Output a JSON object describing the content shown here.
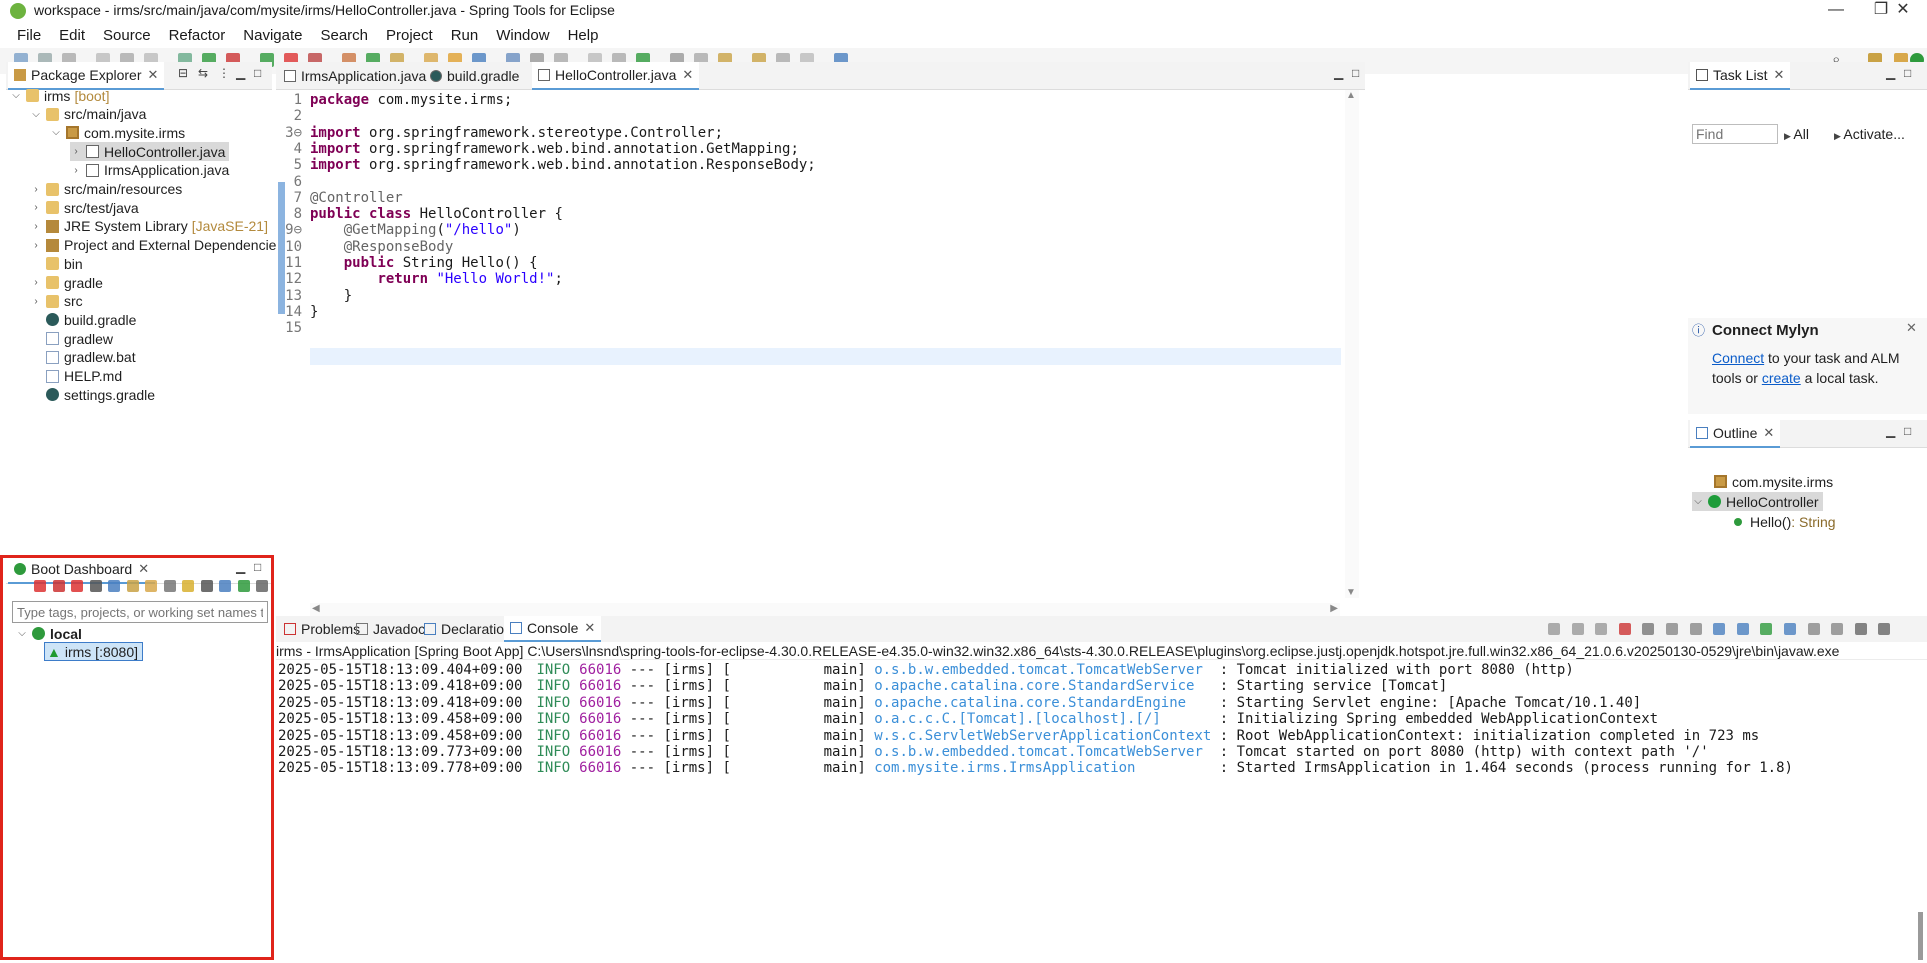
{
  "titlebar": {
    "title": "workspace - irms/src/main/java/com/mysite/irms/HelloController.java - Spring Tools for Eclipse",
    "minimize": "—",
    "maximize": "❐",
    "close": "✕"
  },
  "menubar": [
    "File",
    "Edit",
    "Source",
    "Refactor",
    "Navigate",
    "Search",
    "Project",
    "Run",
    "Window",
    "Help"
  ],
  "package_explorer": {
    "tab_label": "Package Explorer",
    "tree": [
      {
        "label": "irms",
        "deco": "[boot]"
      },
      {
        "label": "src/main/java"
      },
      {
        "label": "com.mysite.irms"
      },
      {
        "label": "HelloController.java"
      },
      {
        "label": "IrmsApplication.java"
      },
      {
        "label": "src/main/resources"
      },
      {
        "label": "src/test/java"
      },
      {
        "label": "JRE System Library",
        "deco": "[JavaSE-21]"
      },
      {
        "label": "Project and External Dependencies"
      },
      {
        "label": "bin"
      },
      {
        "label": "gradle"
      },
      {
        "label": "src"
      },
      {
        "label": "build.gradle"
      },
      {
        "label": "gradlew"
      },
      {
        "label": "gradlew.bat"
      },
      {
        "label": "HELP.md"
      },
      {
        "label": "settings.gradle"
      }
    ]
  },
  "boot_dashboard": {
    "tab_label": "Boot Dashboard",
    "filter_placeholder": "Type tags, projects, or working set names to match",
    "local_label": "local",
    "app_label": "irms [:8080]"
  },
  "editor": {
    "tabs": [
      "IrmsApplication.java",
      "build.gradle",
      "HelloController.java"
    ],
    "lines": [
      {
        "n": "1",
        "segs": [
          {
            "k": "kw",
            "t": "package"
          },
          {
            "k": "",
            "t": " com.mysite.irms;"
          }
        ]
      },
      {
        "n": "2",
        "segs": []
      },
      {
        "n": "3⊖",
        "segs": [
          {
            "k": "kw",
            "t": "import"
          },
          {
            "k": "",
            "t": " org.springframework.stereotype.Controller;"
          }
        ]
      },
      {
        "n": "4",
        "segs": [
          {
            "k": "kw",
            "t": "import"
          },
          {
            "k": "",
            "t": " org.springframework.web.bind.annotation.GetMapping;"
          }
        ]
      },
      {
        "n": "5",
        "segs": [
          {
            "k": "kw",
            "t": "import"
          },
          {
            "k": "",
            "t": " org.springframework.web.bind.annotation.ResponseBody;"
          }
        ]
      },
      {
        "n": "6",
        "segs": []
      },
      {
        "n": "7",
        "segs": [
          {
            "k": "ann",
            "t": "@Controller"
          }
        ]
      },
      {
        "n": "8",
        "segs": [
          {
            "k": "kw",
            "t": "public class"
          },
          {
            "k": "",
            "t": " HelloController {"
          }
        ]
      },
      {
        "n": "9⊖",
        "segs": [
          {
            "k": "",
            "t": "    "
          },
          {
            "k": "ann",
            "t": "@GetMapping"
          },
          {
            "k": "",
            "t": "("
          },
          {
            "k": "str",
            "t": "\"/hello\""
          },
          {
            "k": "",
            "t": ")"
          }
        ]
      },
      {
        "n": "10",
        "segs": [
          {
            "k": "",
            "t": "    "
          },
          {
            "k": "ann",
            "t": "@ResponseBody"
          }
        ]
      },
      {
        "n": "11",
        "segs": [
          {
            "k": "",
            "t": "    "
          },
          {
            "k": "kw",
            "t": "public"
          },
          {
            "k": "",
            "t": " String Hello() {"
          }
        ]
      },
      {
        "n": "12",
        "segs": [
          {
            "k": "",
            "t": "        "
          },
          {
            "k": "kw",
            "t": "return"
          },
          {
            "k": "",
            "t": " "
          },
          {
            "k": "str",
            "t": "\"Hello World!\""
          },
          {
            "k": "",
            "t": ";"
          }
        ]
      },
      {
        "n": "13",
        "segs": [
          {
            "k": "",
            "t": "    }"
          }
        ]
      },
      {
        "n": "14",
        "segs": [
          {
            "k": "",
            "t": "}"
          }
        ]
      },
      {
        "n": "15",
        "segs": []
      }
    ]
  },
  "task_list": {
    "tab_label": "Task List",
    "find_placeholder": "Find",
    "all_label": "All",
    "activate_label": "Activate..."
  },
  "mylyn": {
    "title": "Connect Mylyn",
    "connect_link": "Connect",
    "text1": " to your task and ALM tools or ",
    "create_link": "create",
    "text2": " a local task."
  },
  "outline": {
    "tab_label": "Outline",
    "package": "com.mysite.irms",
    "class": "HelloController",
    "method": "Hello()",
    "method_type": " : String"
  },
  "console": {
    "tabs": [
      "Problems",
      "Javadoc",
      "Declaration",
      "Console"
    ],
    "header": "irms - IrmsApplication [Spring Boot App] C:\\Users\\lnsnd\\spring-tools-for-eclipse-4.30.0.RELEASE-e4.35.0-win32.win32.x86_64\\sts-4.30.0.RELEASE\\plugins\\org.eclipse.justj.openjdk.hotspot.jre.full.win32.x86_64_21.0.6.v20250130-0529\\jre\\bin\\javaw.exe",
    "lines": [
      {
        "ts": "2025-05-15T18:13:09.404+09:00",
        "lvl": "INFO",
        "pid": "66016",
        "mid": " --- [irms] [           main] ",
        "logger": "o.s.b.w.embedded.tomcat.TomcatWebServer ",
        "msg": " : Tomcat initialized with port 8080 (http)"
      },
      {
        "ts": "2025-05-15T18:13:09.418+09:00",
        "lvl": "INFO",
        "pid": "66016",
        "mid": " --- [irms] [           main] ",
        "logger": "o.apache.catalina.core.StandardService  ",
        "msg": " : Starting service [Tomcat]"
      },
      {
        "ts": "2025-05-15T18:13:09.418+09:00",
        "lvl": "INFO",
        "pid": "66016",
        "mid": " --- [irms] [           main] ",
        "logger": "o.apache.catalina.core.StandardEngine   ",
        "msg": " : Starting Servlet engine: [Apache Tomcat/10.1.40]"
      },
      {
        "ts": "2025-05-15T18:13:09.458+09:00",
        "lvl": "INFO",
        "pid": "66016",
        "mid": " --- [irms] [           main] ",
        "logger": "o.a.c.c.C.[Tomcat].[localhost].[/]      ",
        "msg": " : Initializing Spring embedded WebApplicationContext"
      },
      {
        "ts": "2025-05-15T18:13:09.458+09:00",
        "lvl": "INFO",
        "pid": "66016",
        "mid": " --- [irms] [           main] ",
        "logger": "w.s.c.ServletWebServerApplicationContext",
        "msg": " : Root WebApplicationContext: initialization completed in 723 ms"
      },
      {
        "ts": "2025-05-15T18:13:09.773+09:00",
        "lvl": "INFO",
        "pid": "66016",
        "mid": " --- [irms] [           main] ",
        "logger": "o.s.b.w.embedded.tomcat.TomcatWebServer ",
        "msg": " : Tomcat started on port 8080 (http) with context path '/'"
      },
      {
        "ts": "2025-05-15T18:13:09.778+09:00",
        "lvl": "INFO",
        "pid": "66016",
        "mid": " --- [irms] [           main] ",
        "logger": "com.mysite.irms.IrmsApplication         ",
        "msg": " : Started IrmsApplication in 1.464 seconds (process running for 1.8)"
      }
    ]
  },
  "colors": {
    "highlight": "#e0241b",
    "keyword": "#7f0055",
    "string": "#2a00ff",
    "link": "#0b5cc9"
  }
}
